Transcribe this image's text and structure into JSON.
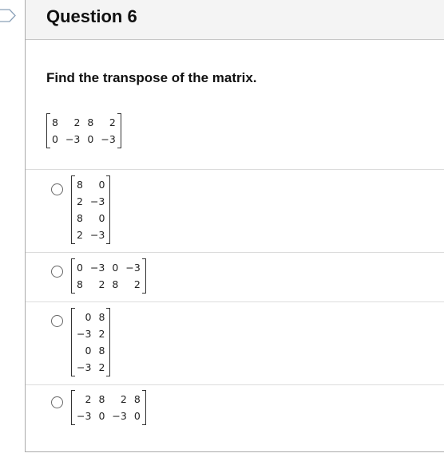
{
  "question": {
    "title": "Question 6",
    "prompt": "Find the transpose of the matrix.",
    "matrix": [
      [
        "8",
        "2",
        "8",
        "2"
      ],
      [
        "0",
        "−3",
        "0",
        "−3"
      ]
    ]
  },
  "options": [
    {
      "id": "a",
      "selected": false,
      "matrix": [
        [
          "8",
          "0"
        ],
        [
          "2",
          "−3"
        ],
        [
          "8",
          "0"
        ],
        [
          "2",
          "−3"
        ]
      ]
    },
    {
      "id": "b",
      "selected": false,
      "matrix": [
        [
          "0",
          "−3",
          "0",
          "−3"
        ],
        [
          "8",
          "2",
          "8",
          "2"
        ]
      ]
    },
    {
      "id": "c",
      "selected": false,
      "matrix": [
        [
          "0",
          "8"
        ],
        [
          "−3",
          "2"
        ],
        [
          "0",
          "8"
        ],
        [
          "−3",
          "2"
        ]
      ]
    },
    {
      "id": "d",
      "selected": false,
      "matrix": [
        [
          "2",
          "8",
          "2",
          "8"
        ],
        [
          "−3",
          "0",
          "−3",
          "0"
        ]
      ]
    }
  ],
  "colors": {
    "header_bg": "#f4f4f4",
    "border": "#aaaaaa",
    "divider": "#dcdcdc"
  }
}
